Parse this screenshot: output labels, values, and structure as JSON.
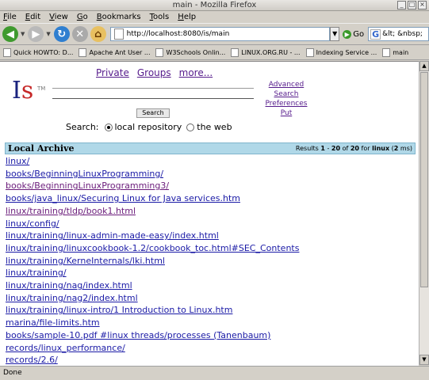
{
  "window": {
    "title": "main - Mozilla Firefox"
  },
  "menu": [
    "File",
    "Edit",
    "View",
    "Go",
    "Bookmarks",
    "Tools",
    "Help"
  ],
  "toolbar": {
    "url": "http://localhost:8080/is/main",
    "go_label": "Go",
    "search_value": "&lt; &nbsp;"
  },
  "bookmarks": [
    "Quick HOWTO: D...",
    "Apache Ant User ...",
    "W3Schools Onlin...",
    "LINUX.ORG.RU - ...",
    "Indexing Service ...",
    "main"
  ],
  "page": {
    "logo_i": "I",
    "logo_s": "s",
    "logo_tm": "TM",
    "top_links": [
      "Private",
      "Groups",
      "more..."
    ],
    "right_links": [
      "Advanced Search",
      "Preferences",
      "Put"
    ],
    "search_button": "Search",
    "scope_label": "Search:",
    "scope_options": [
      "local repository",
      "the web"
    ],
    "archive_title": "Local Archive",
    "results_summary": {
      "prefix": "Results ",
      "from": "1",
      "dash": " - ",
      "to": "20",
      "of": " of ",
      "total": "20",
      "for": " for ",
      "query": "linux",
      "time_open": " (",
      "time": "2",
      "time_close": " ms)"
    },
    "results": [
      "linux/",
      "books/BeginningLinuxProgramming/",
      "books/BeginningLinuxProgramming3/",
      "books/java_linux/Securing Linux for Java services.htm",
      "linux/training/tldp/book1.html",
      "linux/config/",
      "linux/training/linux-admin-made-easy/index.html",
      "linux/training/linuxcookbook-1.2/cookbook_toc.html#SEC_Contents",
      "linux/training/KerneInternals/lki.html",
      "linux/training/",
      "linux/training/nag/index.html",
      "linux/training/nag2/index.html",
      "linux/training/linux-intro/1 Introduction to Linux.htm",
      "marina/file-limits.htm",
      "books/sample-10.pdf #linux threads/processes (Tanenbaum)",
      "records/linux_performance/",
      "records/2.6/"
    ]
  },
  "status": {
    "text": "Done"
  }
}
